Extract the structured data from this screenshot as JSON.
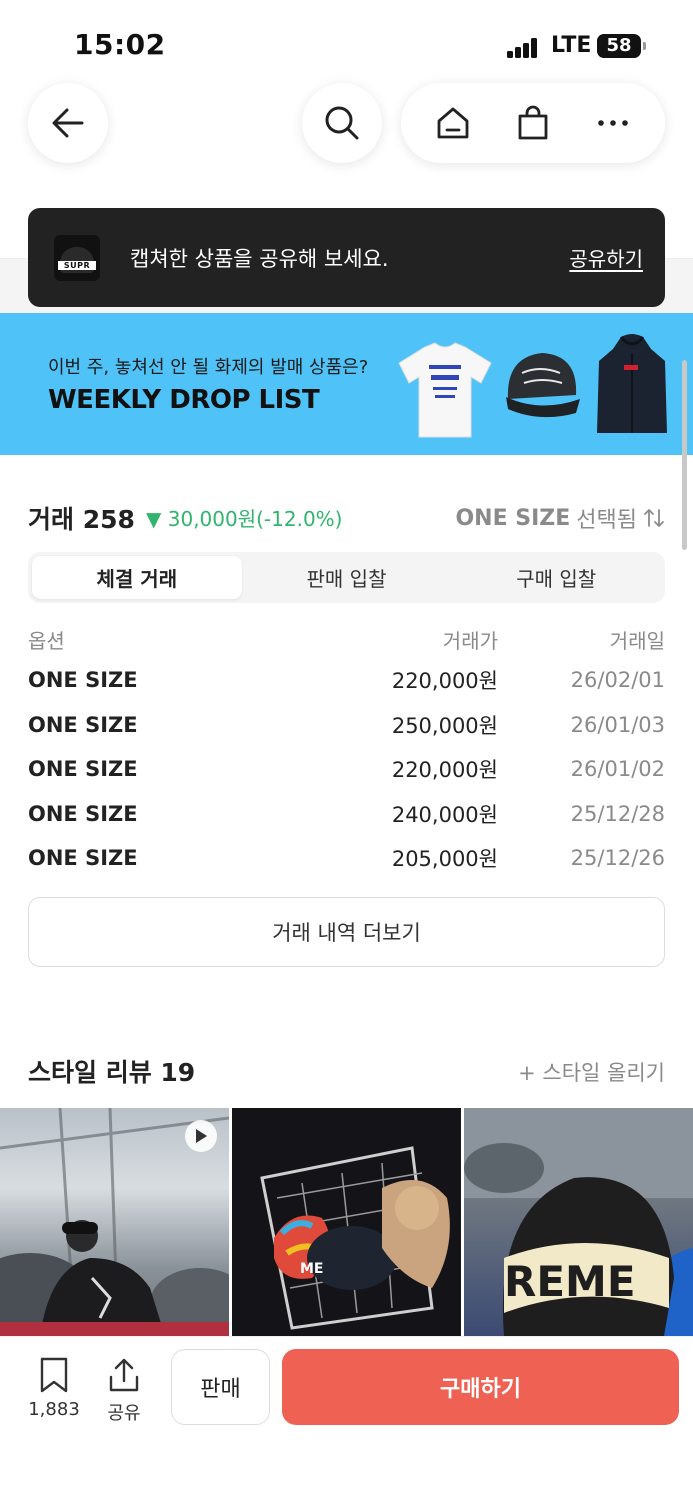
{
  "status_bar": {
    "time": "15:02",
    "network": "LTE",
    "battery": "58"
  },
  "nav": {
    "back_icon": "arrow-left-icon",
    "search_icon": "search-icon",
    "home_icon": "home-icon",
    "cart_icon": "shopping-bag-icon",
    "more_icon": "more-dots-icon"
  },
  "toast": {
    "message": "캡쳐한 상품을 공유해 보세요.",
    "action": "공유하기",
    "thumb_text": "SUPR"
  },
  "banner": {
    "subtitle": "이번 주, 놓쳐선 안 될 화제의 발매 상품은?",
    "title": "WEEKLY DROP LIST",
    "background": "#4fc3f7"
  },
  "trade": {
    "count_label": "거래 258",
    "change_arrow": "▼",
    "change_text": "30,000원(-12.0%)",
    "size_value": "ONE SIZE",
    "size_suffix": "선택됨",
    "tabs": [
      "체결 거래",
      "판매 입찰",
      "구매 입찰"
    ],
    "active_tab": 0,
    "columns": {
      "option": "옵션",
      "price": "거래가",
      "date": "거래일"
    },
    "rows": [
      {
        "option": "ONE SIZE",
        "price": "220,000원",
        "date": "26/02/01"
      },
      {
        "option": "ONE SIZE",
        "price": "250,000원",
        "date": "26/01/03"
      },
      {
        "option": "ONE SIZE",
        "price": "220,000원",
        "date": "26/01/02"
      },
      {
        "option": "ONE SIZE",
        "price": "240,000원",
        "date": "25/12/28"
      },
      {
        "option": "ONE SIZE",
        "price": "205,000원",
        "date": "25/12/26"
      }
    ],
    "more_label": "거래 내역 더보기"
  },
  "style_review": {
    "title": "스타일 리뷰 19",
    "upload": "+ 스타일 올리기",
    "overlay_text_2": "ME",
    "overlay_text_3": "REME"
  },
  "bottom_bar": {
    "save_count": "1,883",
    "share_label": "공유",
    "sell_label": "판매",
    "buy_label": "구매하기",
    "accent": "#ef6253"
  }
}
